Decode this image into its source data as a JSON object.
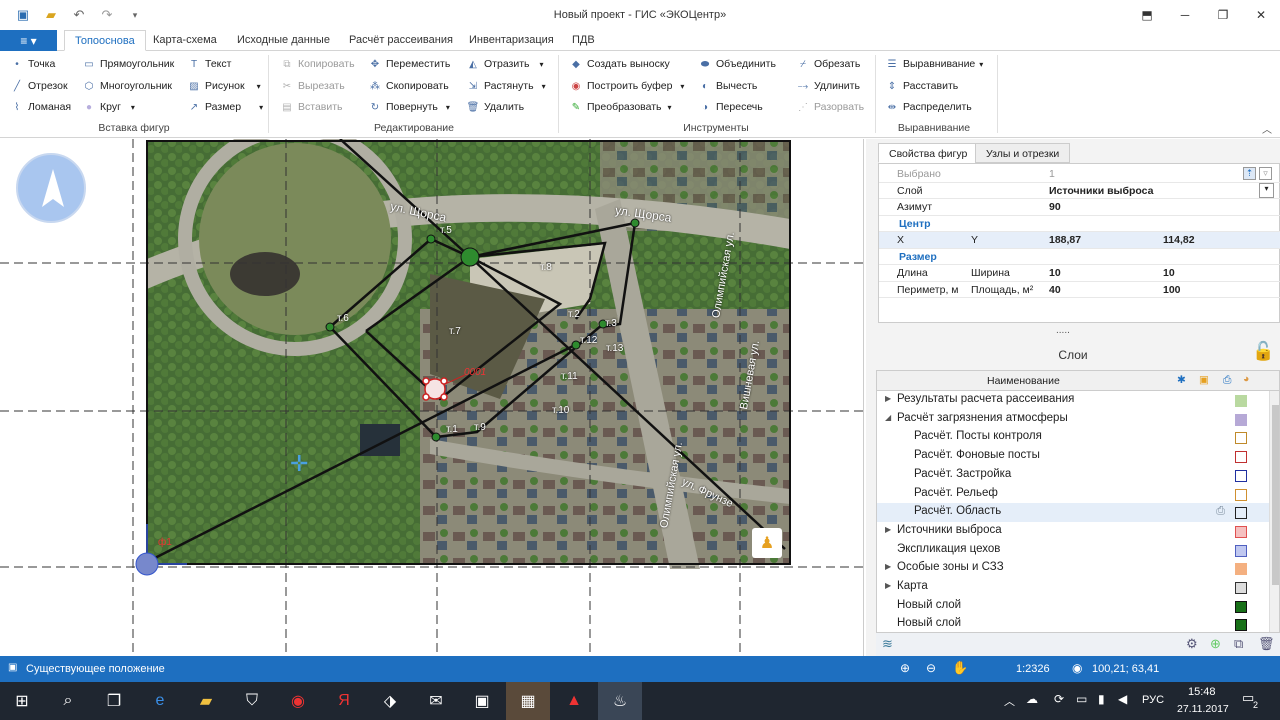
{
  "window": {
    "title": "Новый проект - ГИС «ЭКОЦентр»"
  },
  "file_menu": {
    "label": "≡ ▾"
  },
  "tabs": [
    {
      "label": "Топооснова"
    },
    {
      "label": "Карта-схема"
    },
    {
      "label": "Исходные данные"
    },
    {
      "label": "Расчёт рассеивания"
    },
    {
      "label": "Инвентаризация"
    },
    {
      "label": "ПДВ"
    }
  ],
  "ribbon": {
    "insert": {
      "label": "Вставка фигур",
      "items": [
        "Точка",
        "Отрезок",
        "Ломаная",
        "Прямоугольник",
        "Многоугольник",
        "Круг",
        "Текст",
        "Рисунок",
        "Размер"
      ]
    },
    "edit": {
      "label": "Редактирование",
      "items": [
        "Копировать",
        "Вырезать",
        "Вставить",
        "Переместить",
        "Скопировать",
        "Повернуть",
        "Отразить",
        "Растянуть",
        "Удалить"
      ]
    },
    "tools": {
      "label": "Инструменты",
      "items": [
        "Создать выноску",
        "Построить буфер",
        "Преобразовать",
        "Объединить",
        "Вычесть",
        "Пересечь",
        "Обрезать",
        "Удлинить",
        "Разорвать"
      ]
    },
    "align": {
      "label": "Выравнивание",
      "items": [
        "Выравнивание",
        "Расставить",
        "Распределить"
      ]
    }
  },
  "map": {
    "streets": [
      "ул. Щорса",
      "ул. Щорса",
      "Олимпийская ул.",
      "Вишневая ул.",
      "Олимпийская ул.",
      "ул. Фрунзе"
    ],
    "points": [
      "т.1",
      "т.2",
      "т.3",
      "т.5",
      "т.6",
      "т.7",
      "т.8",
      "т.9",
      "т.10",
      "т.11",
      "т.12",
      "т.13"
    ],
    "source_label": "0001",
    "origin_label": "ф1"
  },
  "props": {
    "tabs": [
      "Свойства фигур",
      "Узлы и отрезки"
    ],
    "selected_label": "Выбрано",
    "selected_value": "1",
    "layer_label": "Слой",
    "layer_value": "Источники выброса",
    "azimuth_label": "Азимут",
    "azimuth_value": "90",
    "center_label": "Центр",
    "x_label": "X",
    "y_label": "Y",
    "x_value": "188,87",
    "y_value": "114,82",
    "size_label": "Размер",
    "length_label": "Длина",
    "width_label": "Ширина",
    "length_value": "10",
    "width_value": "10",
    "perimeter_label": "Периметр, м",
    "area_label": "Площадь, м²",
    "perimeter_value": "40",
    "area_value": "100",
    "dots": "....."
  },
  "layers": {
    "title": "Слои",
    "header": "Наименование",
    "items": [
      {
        "label": "Результаты расчета рассеивания",
        "color": "#b9d9a0"
      },
      {
        "label": "Расчёт загрязнения атмосферы",
        "color": "#b6a9d6"
      },
      {
        "label": "Расчёт. Посты контроля",
        "color": "#e0b050"
      },
      {
        "label": "Расчёт. Фоновые посты",
        "color": "#c03030"
      },
      {
        "label": "Расчёт. Застройка",
        "color": "#2030a0"
      },
      {
        "label": "Расчёт. Рельеф",
        "color": "#d09030"
      },
      {
        "label": "Расчёт. Область",
        "color": "#222222"
      },
      {
        "label": "Источники выброса",
        "color": "#e05050"
      },
      {
        "label": "Экспликация цехов",
        "color": "#8090e0"
      },
      {
        "label": "Особые зоны и СЗЗ",
        "color": "#f4b080"
      },
      {
        "label": "Карта",
        "color": "#555555"
      },
      {
        "label": "Новый слой",
        "color": "#187018"
      },
      {
        "label": "Новый слой",
        "color": "#187018"
      }
    ]
  },
  "status": {
    "left": "Существующее положение",
    "scale": "1:2326",
    "coords": "100,21; 63,41"
  },
  "taskbar": {
    "lang": "РУС",
    "time": "15:48",
    "date": "27.11.2017",
    "notif": "2"
  }
}
